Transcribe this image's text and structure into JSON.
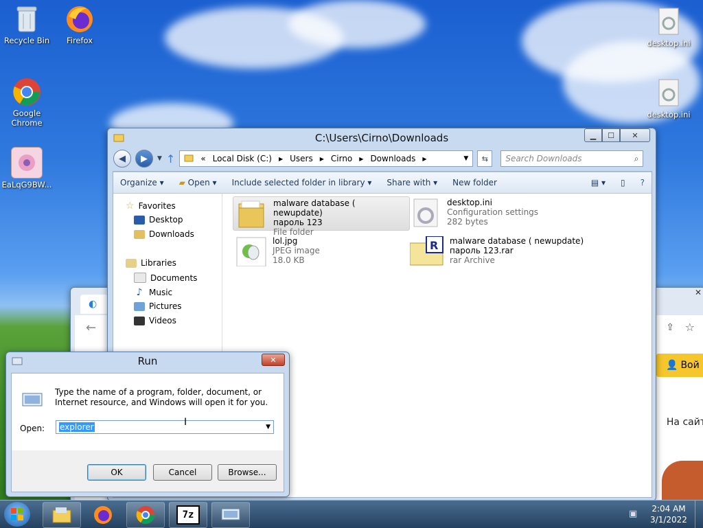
{
  "desktop": {
    "icons": [
      {
        "label": "Recycle Bin"
      },
      {
        "label": "Firefox"
      },
      {
        "label": "Google Chrome"
      },
      {
        "label": "EaLqG9BW..."
      },
      {
        "label": "desktop.ini"
      },
      {
        "label": "desktop.ini"
      }
    ]
  },
  "explorer": {
    "title": "C:\\Users\\Cirno\\Downloads",
    "address": {
      "prefix": "«",
      "crumbs": [
        "Local Disk (C:)",
        "Users",
        "Cirno",
        "Downloads"
      ]
    },
    "search_placeholder": "Search Downloads",
    "toolbar": {
      "organize": "Organize",
      "open": "Open",
      "include": "Include selected folder in library",
      "share": "Share with",
      "new_folder": "New folder"
    },
    "nav": {
      "favorites": "Favorites",
      "desktop": "Desktop",
      "downloads": "Downloads",
      "libraries": "Libraries",
      "documents": "Documents",
      "music": "Music",
      "pictures": "Pictures",
      "videos": "Videos"
    },
    "files": [
      {
        "name1": "malware database ( newupdate)",
        "name2": "пароль 123",
        "type": "File folder",
        "size": ""
      },
      {
        "name1": "desktop.ini",
        "name2": "",
        "type": "Configuration settings",
        "size": "282 bytes"
      },
      {
        "name1": "lol.jpg",
        "name2": "",
        "type": "JPEG image",
        "size": "18.0 KB"
      },
      {
        "name1": "malware database ( newupdate)",
        "name2": "пароль 123.rar",
        "type": "rar Archive",
        "size": ""
      }
    ]
  },
  "run": {
    "title": "Run",
    "description": "Type the name of a program, folder, document, or Internet resource, and Windows will open it for you.",
    "open_label": "Open:",
    "input_value": "explorer",
    "ok": "OK",
    "cancel": "Cancel",
    "browse": "Browse..."
  },
  "browser": {
    "login": "Вой",
    "text": "На сайт"
  },
  "taskbar": {
    "time": "2:04 AM",
    "date": "3/1/2022",
    "zip_label": "7z"
  }
}
